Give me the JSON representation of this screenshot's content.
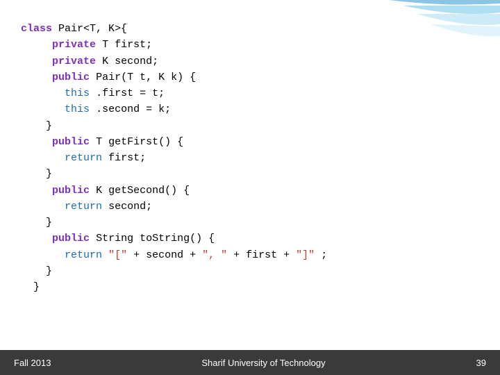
{
  "slide": {
    "code": {
      "line1": "class Pair<T, K>{",
      "line2": "    private T first;",
      "line3": "    private K second;",
      "line4": "    public Pair(T t, K k) {",
      "line5": "      this.first = t;",
      "line6": "      this.second = k;",
      "line7": "    }",
      "line8": "    public T getFirst() {",
      "line9": "      return first;",
      "line10": "    }",
      "line11": "    public K getSecond() {",
      "line12": "      return second;",
      "line13": "    }",
      "line14": "    public String toString() {",
      "line15": "      return \"[\" + second + \", \" + first + \"]\";",
      "line16": "    }",
      "line17": "  }"
    },
    "footer": {
      "left": "Fall 2013",
      "center": "Sharif University of Technology",
      "right": "39"
    }
  }
}
